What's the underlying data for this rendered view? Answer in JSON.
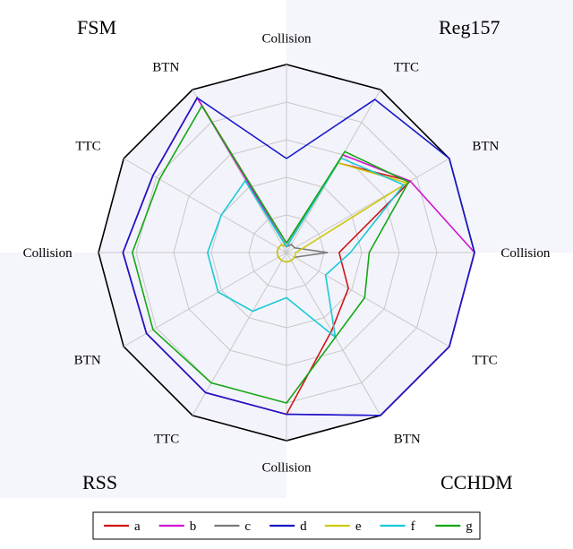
{
  "chart_data": {
    "type": "radar",
    "axes": [
      "Collision",
      "TTC",
      "BTN",
      "Collision",
      "TTC",
      "BTN",
      "Collision",
      "TTC",
      "BTN",
      "Collision",
      "TTC",
      "BTN"
    ],
    "corners": {
      "tl": "FSM",
      "tr": "Reg157",
      "br": "CCHDM",
      "bl": "RSS"
    },
    "rlim": [
      0,
      1
    ],
    "rings": [
      0.2,
      0.4,
      0.6,
      0.8,
      1.0
    ],
    "series": [
      {
        "name": "a",
        "color": "#d11515",
        "values": [
          0.05,
          0.55,
          0.76,
          0.28,
          0.38,
          0.48,
          0.86,
          0.86,
          0.86,
          0.87,
          0.82,
          0.95
        ]
      },
      {
        "name": "b",
        "color": "#d015d0",
        "values": [
          0.03,
          0.6,
          0.76,
          1.0,
          1.0,
          1.0,
          0.86,
          0.86,
          0.86,
          0.87,
          0.82,
          0.95
        ]
      },
      {
        "name": "c",
        "color": "#7a7a7a",
        "values": [
          0.03,
          0.05,
          0.05,
          0.22,
          0.05,
          0.05,
          0.05,
          0.05,
          0.05,
          0.05,
          0.05,
          0.05
        ]
      },
      {
        "name": "d",
        "color": "#1818c8",
        "values": [
          0.5,
          0.94,
          1.0,
          1.0,
          1.0,
          1.0,
          0.86,
          0.86,
          0.86,
          0.87,
          0.82,
          0.95
        ]
      },
      {
        "name": "e",
        "color": "#cfc80f",
        "values": [
          0.03,
          0.55,
          0.74,
          0.05,
          0.05,
          0.05,
          0.05,
          0.05,
          0.05,
          0.05,
          0.05,
          0.05
        ]
      },
      {
        "name": "f",
        "color": "#17c9d7",
        "values": [
          0.03,
          0.58,
          0.72,
          0.34,
          0.24,
          0.52,
          0.24,
          0.36,
          0.42,
          0.42,
          0.4,
          0.44
        ]
      },
      {
        "name": "g",
        "color": "#15a715",
        "values": [
          0.05,
          0.62,
          0.75,
          0.44,
          0.48,
          0.52,
          0.8,
          0.8,
          0.82,
          0.82,
          0.78,
          0.9
        ]
      }
    ],
    "legend": [
      "a",
      "b",
      "c",
      "d",
      "e",
      "f",
      "g"
    ]
  },
  "geom": {
    "cx": 320,
    "cy": 282,
    "R": 210
  }
}
